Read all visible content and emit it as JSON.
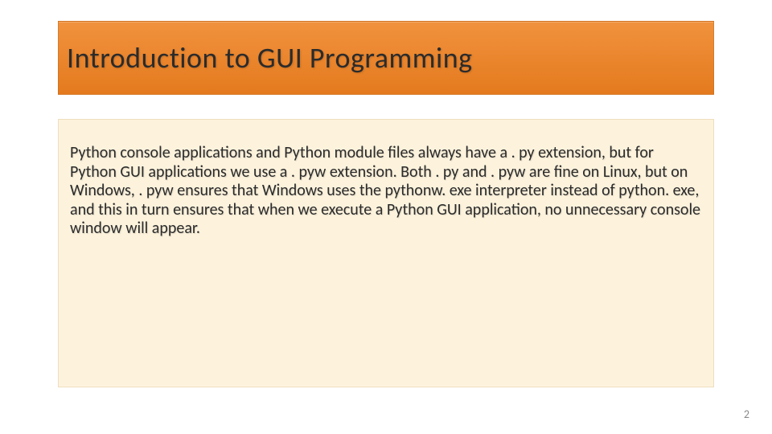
{
  "slide": {
    "title": "Introduction to GUI Programming",
    "body": "Python console applications and Python module ﬁles always have a . py extension, but for Python GUI applications we use a . pyw extension. Both . py and . pyw are ﬁne on Linux, but on Windows, . pyw ensures that Windows uses the pythonw. exe interpreter instead of python. exe, and this in turn ensures that when we execute a Python GUI application, no unnecessary console window will appear.",
    "page_number": "2"
  }
}
